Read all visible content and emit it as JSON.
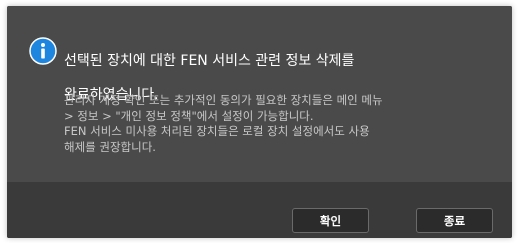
{
  "dialog": {
    "icon": "info-icon",
    "title_line1": "선택된 장치에 대한 FEN 서비스 관련 정보 삭제를",
    "title_line2": "완료하였습니다.",
    "desc_paragraph1": "관리자 계정 확인 또는 추가적인 동의가 필요한 장치들은 메인 메뉴\n> 정보 > \"개인 정보 정책\"에서 설정이 가능합니다.",
    "desc_paragraph2": "FEN 서비스 미사용 처리된 장치들은 로컬 장치 설정에서도 사용\n해제를 권장합니다.",
    "ok_label": "확인",
    "close_label": "종료"
  },
  "colors": {
    "dialog_bg": "#4a4a4a",
    "footer_bg": "#3a3a3a",
    "icon_blue": "#1f86e0",
    "button_bg": "#2b2b2b"
  }
}
